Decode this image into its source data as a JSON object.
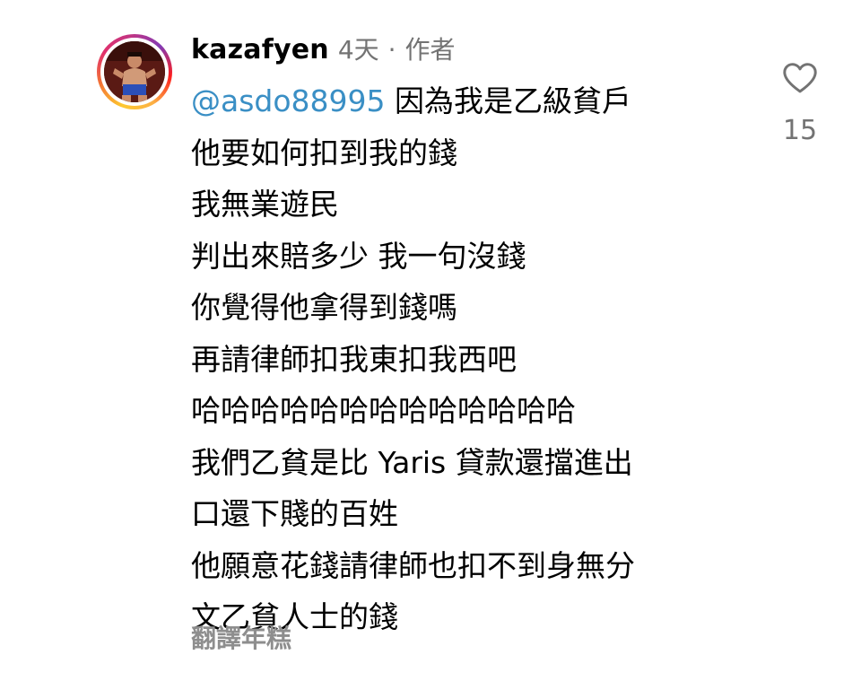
{
  "comment": {
    "username": "kazafyen",
    "time": "4天",
    "separator": "·",
    "author_badge": "作者",
    "mention": "@asdo88995",
    "lines": [
      "因為我是乙級貧戶",
      "他要如何扣到我的錢",
      "我無業遊民",
      "判出來賠多少 我一句沒錢",
      "你覺得他拿得到錢嗎",
      "再請律師扣我東扣我西吧",
      "哈哈哈哈哈哈哈哈哈哈哈哈哈",
      "我們乙貧是比 Yaris 貸款還擋進出",
      "口還下賤的百姓",
      "他願意花錢請律師也扣不到身無分",
      "文乙貧人士的錢"
    ],
    "translate_label": "翻譯年糕",
    "like_count": "15",
    "icons": {
      "like": "heart-outline-icon",
      "avatar": "profile-avatar"
    },
    "colors": {
      "mention": "#3a8fc5",
      "meta": "#737373",
      "translate": "#8e8e8e"
    }
  }
}
